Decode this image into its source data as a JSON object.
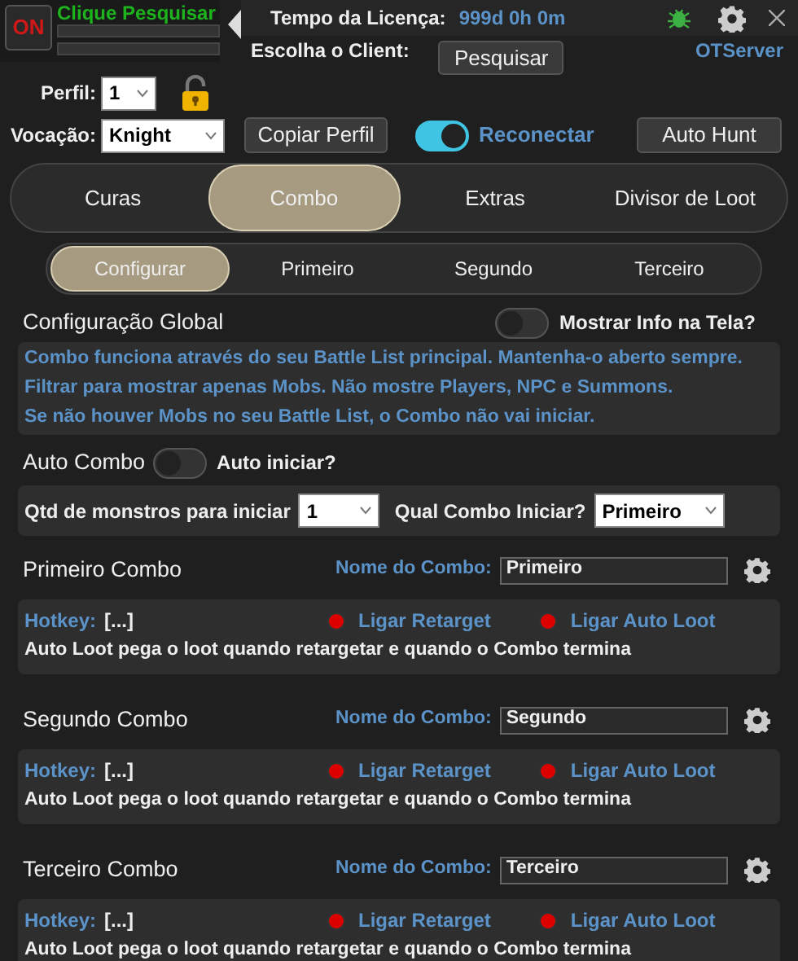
{
  "header": {
    "power_label": "ON",
    "status": "Clique Pesquisar",
    "license_label": "Tempo da Licença:",
    "license_value": "999d 0h 0m",
    "client_label": "Escolha o Client:",
    "search_button": "Pesquisar",
    "server": "OTServer"
  },
  "profile": {
    "label": "Perfil:",
    "value": "1",
    "locked": false
  },
  "vocation": {
    "label": "Vocação:",
    "value": "Knight"
  },
  "copy_button": "Copiar Perfil",
  "reconnect": {
    "label": "Reconectar",
    "on": true
  },
  "auto_hunt_button": "Auto Hunt",
  "tabs": [
    {
      "label": "Curas",
      "selected": false
    },
    {
      "label": "Combo",
      "selected": true
    },
    {
      "label": "Extras",
      "selected": false
    },
    {
      "label": "Divisor de Loot",
      "selected": false
    }
  ],
  "subtabs": [
    {
      "label": "Configurar",
      "selected": true
    },
    {
      "label": "Primeiro",
      "selected": false
    },
    {
      "label": "Segundo",
      "selected": false
    },
    {
      "label": "Terceiro",
      "selected": false
    }
  ],
  "global": {
    "title": "Configuração Global",
    "show_info": {
      "label": "Mostrar Info na Tela?",
      "on": false
    },
    "info_lines": [
      "Combo funciona através do seu Battle List principal. Mantenha-o aberto sempre.",
      "Filtrar para mostrar apenas Mobs. Não mostre Players, NPC e Summons.",
      "Se não houver Mobs no seu Battle List, o Combo não vai iniciar."
    ]
  },
  "auto_combo": {
    "label": "Auto Combo",
    "on": false,
    "hint": "Auto iniciar?"
  },
  "monsters": {
    "label": "Qtd de monstros para iniciar",
    "value": "1"
  },
  "start_combo": {
    "label": "Qual Combo Iniciar?",
    "value": "Primeiro"
  },
  "combos": [
    {
      "title": "Primeiro Combo",
      "name_label": "Nome do Combo:",
      "name": "Primeiro",
      "hotkey_label": "Hotkey:",
      "hotkey": "[...]",
      "retarget": {
        "label": "Ligar Retarget",
        "on": false
      },
      "auto_loot": {
        "label": "Ligar Auto Loot",
        "on": false
      },
      "note": "Auto Loot pega o loot quando retargetar e quando o Combo termina"
    },
    {
      "title": "Segundo Combo",
      "name_label": "Nome do Combo:",
      "name": "Segundo",
      "hotkey_label": "Hotkey:",
      "hotkey": "[...]",
      "retarget": {
        "label": "Ligar Retarget",
        "on": false
      },
      "auto_loot": {
        "label": "Ligar Auto Loot",
        "on": false
      },
      "note": "Auto Loot pega o loot quando retargetar e quando o Combo termina"
    },
    {
      "title": "Terceiro Combo",
      "name_label": "Nome do Combo:",
      "name": "Terceiro",
      "hotkey_label": "Hotkey:",
      "hotkey": "[...]",
      "retarget": {
        "label": "Ligar Retarget",
        "on": false
      },
      "auto_loot": {
        "label": "Ligar Auto Loot",
        "on": false
      },
      "note": "Auto Loot pega o loot quando retargetar e quando o Combo termina"
    }
  ]
}
